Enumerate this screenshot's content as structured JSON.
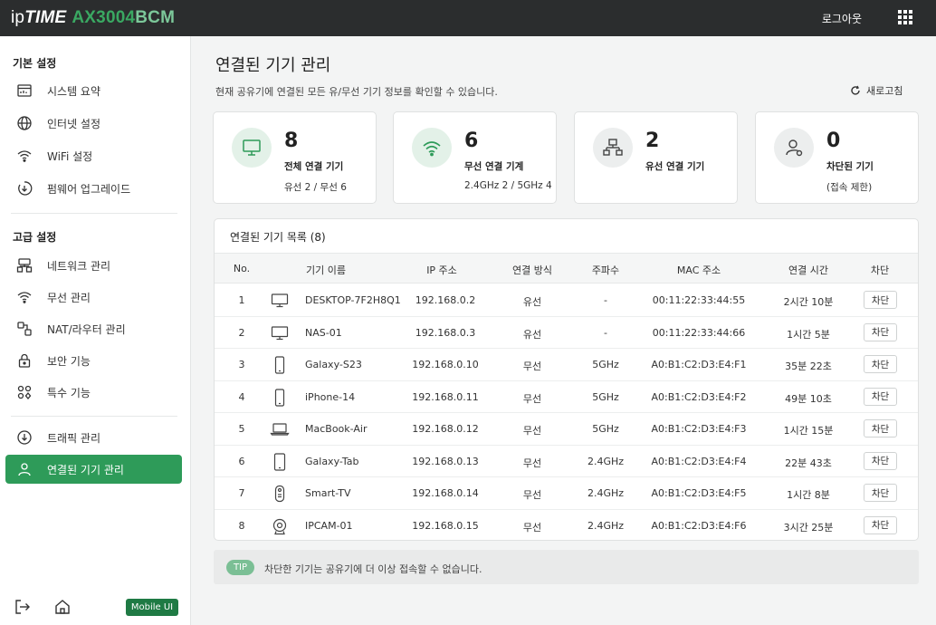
{
  "header": {
    "brand_ip": "ip",
    "brand_time": "TIME",
    "brand_model": "AX3004",
    "brand_bcm": "BCM",
    "logout": "로그아웃",
    "menu_icon": "grid-icon"
  },
  "sidebar": {
    "basic_title": "기본 설정",
    "basic_items": [
      {
        "label": "시스템 요약",
        "icon": "dashboard-icon"
      },
      {
        "label": "인터넷 설정",
        "icon": "globe-icon"
      },
      {
        "label": "WiFi 설정",
        "icon": "wifi-icon"
      },
      {
        "label": "펌웨어 업그레이드",
        "icon": "upgrade-icon"
      }
    ],
    "advanced_title": "고급 설정",
    "advanced_items": [
      {
        "label": "네트워크 관리",
        "icon": "network-icon"
      },
      {
        "label": "무선 관리",
        "icon": "wifi-icon"
      },
      {
        "label": "NAT/라우터 관리",
        "icon": "router-icon"
      },
      {
        "label": "보안 기능",
        "icon": "lock-icon"
      },
      {
        "label": "특수 기능",
        "icon": "apps-icon"
      }
    ],
    "extra_items": [
      {
        "label": "트래픽 관리",
        "icon": "traffic-icon"
      },
      {
        "label": "연결된 기기 관리",
        "icon": "user-icon",
        "active": true
      }
    ],
    "mobile_ui": "Mobile UI"
  },
  "page": {
    "title": "연결된 기기 관리",
    "description": "현재 공유기에 연결된 모든 유/무선 기기 정보를 확인할 수 있습니다.",
    "refresh": "새로고침"
  },
  "cards": [
    {
      "number": "8",
      "label": "전체 연결 기기",
      "sub": "유선 2 / 무선 6",
      "icon": "monitor-icon"
    },
    {
      "number": "6",
      "label": "무선 연결 기계",
      "sub": "2.4GHz 2 / 5GHz 4",
      "icon": "wifi-icon"
    },
    {
      "number": "2",
      "label": "유선 연결 기기",
      "sub": "",
      "icon": "network-icon"
    },
    {
      "number": "0",
      "label": "차단된 기기",
      "sub": "(접속 제한)",
      "icon": "user-blocked-icon"
    }
  ],
  "table": {
    "title": "연결된 기기 목록 (8)",
    "headers": [
      "No.",
      "기기 이름",
      "IP 주소",
      "연결 방식",
      "주파수",
      "MAC 주소",
      "연결 시간",
      "차단"
    ],
    "rows": [
      {
        "no": "1",
        "icon": "monitor-icon",
        "name": "DESKTOP-7F2H8Q1",
        "ip": "192.168.0.2",
        "type": "유선",
        "freq": "-",
        "mac": "00:11:22:33:44:55",
        "time": "2시간 10분",
        "action": "차단"
      },
      {
        "no": "2",
        "icon": "monitor-icon",
        "name": "NAS-01",
        "ip": "192.168.0.3",
        "type": "유선",
        "freq": "-",
        "mac": "00:11:22:33:44:66",
        "time": "1시간 5분",
        "action": "차단"
      },
      {
        "no": "3",
        "icon": "phone-icon",
        "name": "Galaxy-S23",
        "ip": "192.168.0.10",
        "type": "무선",
        "freq": "5GHz",
        "mac": "A0:B1:C2:D3:E4:F1",
        "time": "35분 22초",
        "action": "차단"
      },
      {
        "no": "4",
        "icon": "phone-icon",
        "name": "iPhone-14",
        "ip": "192.168.0.11",
        "type": "무선",
        "freq": "5GHz",
        "mac": "A0:B1:C2:D3:E4:F2",
        "time": "49분 10초",
        "action": "차단"
      },
      {
        "no": "5",
        "icon": "laptop-icon",
        "name": "MacBook-Air",
        "ip": "192.168.0.12",
        "type": "무선",
        "freq": "5GHz",
        "mac": "A0:B1:C2:D3:E4:F3",
        "time": "1시간 15분",
        "action": "차단"
      },
      {
        "no": "6",
        "icon": "tablet-icon",
        "name": "Galaxy-Tab",
        "ip": "192.168.0.13",
        "type": "무선",
        "freq": "2.4GHz",
        "mac": "A0:B1:C2:D3:E4:F4",
        "time": "22분 43초",
        "action": "차단"
      },
      {
        "no": "7",
        "icon": "remote-icon",
        "name": "Smart-TV",
        "ip": "192.168.0.14",
        "type": "무선",
        "freq": "2.4GHz",
        "mac": "A0:B1:C2:D3:E4:F5",
        "time": "1시간 8분",
        "action": "차단"
      },
      {
        "no": "8",
        "icon": "camera-icon",
        "name": "IPCAM-01",
        "ip": "192.168.0.15",
        "type": "무선",
        "freq": "2.4GHz",
        "mac": "A0:B1:C2:D3:E4:F6",
        "time": "3시간 25분",
        "action": "차단"
      }
    ]
  },
  "tip": {
    "badge": "TIP",
    "text": "차단한 기기는 공유기에 더 이상 접속할 수 없습니다."
  },
  "colors": {
    "accent": "#2e9b59",
    "topbar": "#2b2d2e",
    "brand_green": "#3aa862"
  }
}
